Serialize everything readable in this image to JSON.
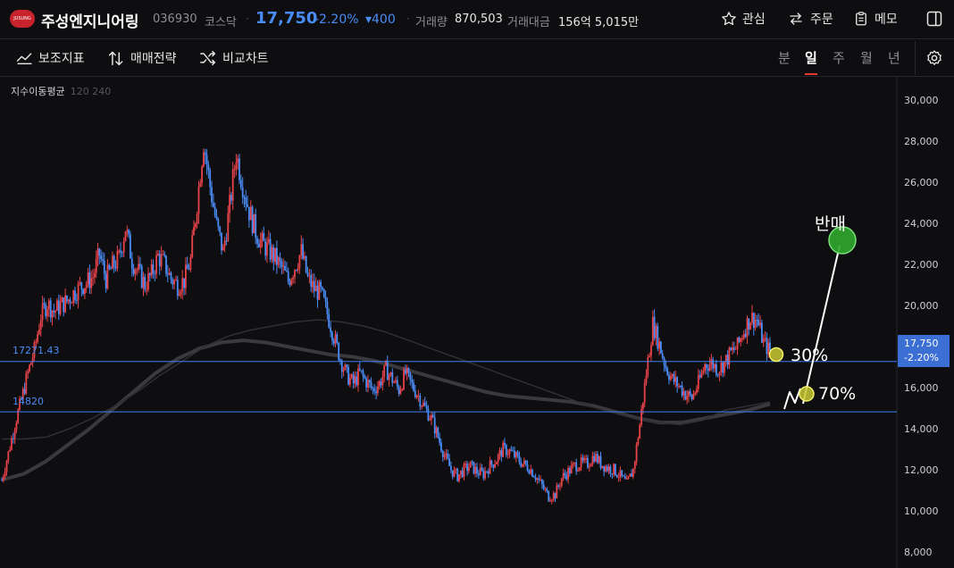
{
  "header": {
    "logo_text": "JUSUNG",
    "stock_name": "주성엔지니어링",
    "stock_code": "036930",
    "market": "코스닥",
    "price": "17,750",
    "change_pct": "-2.20%",
    "change_abs": "▾400",
    "volume_label": "거래량",
    "volume": "870,503",
    "amount_label": "거래대금",
    "amount": "156억 5,015만",
    "watch_label": "관심",
    "order_label": "주문",
    "memo_label": "메모"
  },
  "toolbar": {
    "indicator_label": "보조지표",
    "strategy_label": "매매전략",
    "compare_label": "비교차트",
    "periods": [
      "분",
      "일",
      "주",
      "월",
      "년"
    ],
    "active_period": "일"
  },
  "legend": {
    "title": "지수이동평균",
    "params": "120 240"
  },
  "price_tag": {
    "price": "17,750",
    "change": "-2.20%"
  },
  "chart_data": {
    "type": "candlestick",
    "y_ticks": [
      "30,000",
      "28,000",
      "26,000",
      "24,000",
      "22,000",
      "20,000",
      "17,750",
      "16,000",
      "14,000",
      "12,000",
      "10,000",
      "8,000"
    ],
    "ylim": [
      8000,
      30000
    ],
    "grid": false,
    "series_close": [
      11500,
      12800,
      14200,
      15400,
      16700,
      17800,
      19500,
      20100,
      19700,
      20000,
      20200,
      20600,
      20900,
      21100,
      21400,
      22500,
      21300,
      21900,
      22300,
      23800,
      22200,
      21600,
      21000,
      21500,
      22400,
      22000,
      21300,
      21000,
      21200,
      22200,
      25000,
      28000,
      25800,
      23900,
      22600,
      24800,
      27400,
      25900,
      24600,
      23600,
      23000,
      22700,
      22300,
      21800,
      21200,
      21900,
      22600,
      21300,
      20800,
      20600,
      19600,
      18500,
      17400,
      16600,
      16200,
      16700,
      16300,
      15900,
      16200,
      16900,
      16400,
      15900,
      16700,
      16100,
      15600,
      15000,
      14500,
      13600,
      12700,
      12000,
      11700,
      12000,
      12200,
      11900,
      11800,
      12200,
      12500,
      13000,
      12900,
      12600,
      12300,
      12100,
      11700,
      11200,
      10700,
      10800,
      11600,
      11900,
      12200,
      12300,
      12300,
      12700,
      12300,
      12100,
      12000,
      11700,
      11300,
      12000,
      14200,
      16700,
      19100,
      18100,
      17000,
      16400,
      16100,
      15700,
      15500,
      16200,
      17100,
      17200,
      16900,
      17200,
      17700,
      18000,
      18800,
      19400,
      19300,
      18200,
      17750
    ],
    "ema120": [
      13500,
      13500,
      13600,
      14000,
      14500,
      15100,
      15800,
      16600,
      17300,
      18000,
      18500,
      18800,
      19000,
      19200,
      19300,
      19200,
      19000,
      18700,
      18300,
      17900,
      17500,
      17100,
      16700,
      16300,
      15900,
      15500,
      15100,
      14800,
      14500,
      14300,
      14200,
      14400,
      14900,
      15100,
      15300
    ],
    "ema240": [
      11500,
      11800,
      12400,
      13200,
      14000,
      14900,
      15800,
      16700,
      17400,
      17900,
      18200,
      18300,
      18200,
      18000,
      17800,
      17600,
      17500,
      17300,
      17000,
      16700,
      16400,
      16100,
      15800,
      15600,
      15500,
      15400,
      15300,
      15100,
      14800,
      14500,
      14300,
      14300,
      14500,
      14700,
      14900,
      15200
    ],
    "horizontal_lines": [
      {
        "value": 17271.43,
        "label": "17271.43"
      },
      {
        "value": 14820,
        "label": "14820"
      }
    ],
    "annotations": {
      "sell_label": "반매",
      "target_30": "30%",
      "target_70": "70%"
    }
  },
  "colors": {
    "up": "#e8434a",
    "down": "#4a8cf5",
    "accent": "#4a8cf5",
    "background": "#0e0e10"
  }
}
